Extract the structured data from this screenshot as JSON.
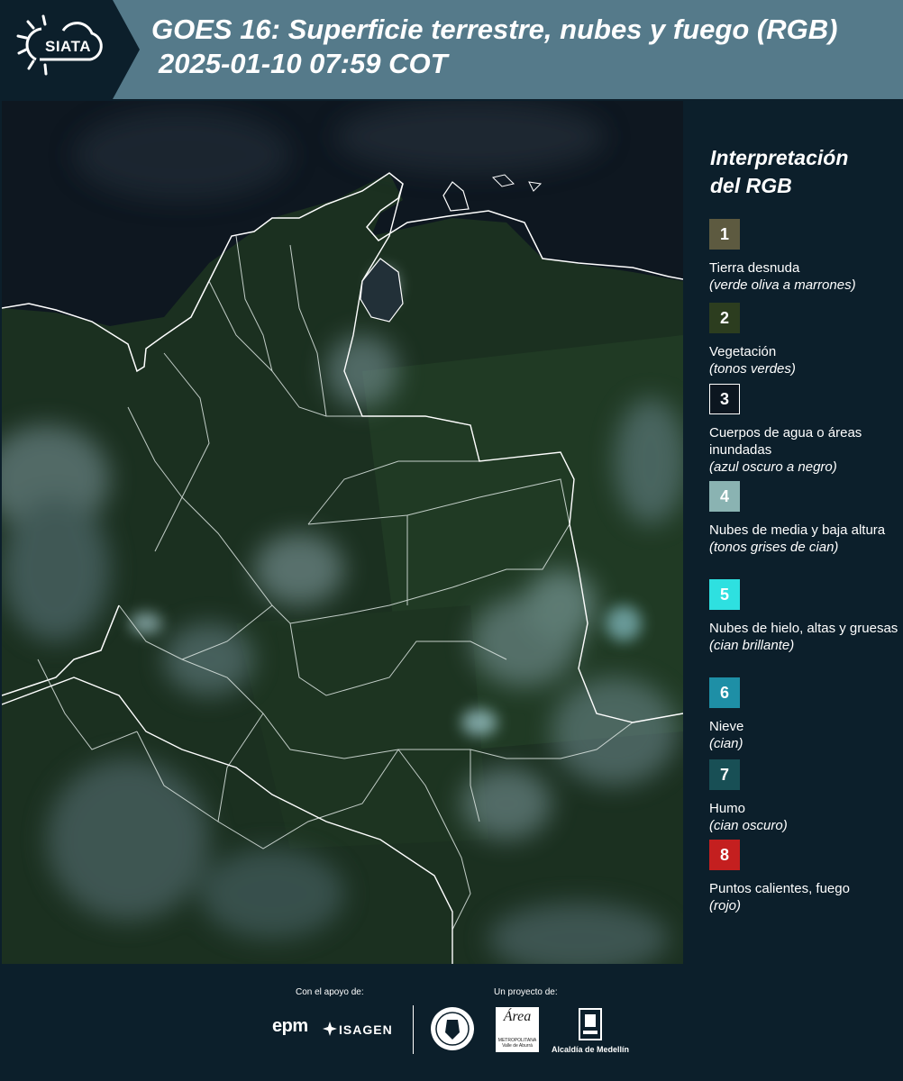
{
  "header": {
    "logo": "SIATA",
    "title_line1": "GOES 16: Superficie terrestre, nubes y fuego (RGB)",
    "title_line2": "2025-01-10 07:59 COT",
    "background": "#557a8a"
  },
  "legend": {
    "title_line1": "Interpretación",
    "title_line2": "del RGB",
    "items": [
      {
        "number": "1",
        "label": "Tierra desnuda",
        "sub": "(verde oliva a marrones)",
        "color": "#5d5a40"
      },
      {
        "number": "2",
        "label": "Vegetación",
        "sub": "(tonos verdes)",
        "color": "#2c3d1f"
      },
      {
        "number": "3",
        "label": "Cuerpos de agua o áreas inundadas",
        "sub": "(azul oscuro a negro)",
        "color": "#0c1620"
      },
      {
        "number": "4",
        "label": "Nubes de media y baja altura",
        "sub": "(tonos grises de cian)",
        "color": "#8ab3b2"
      },
      {
        "number": "5",
        "label": "Nubes de hielo, altas y gruesas",
        "sub": "(cian brillante)",
        "color": "#2ee0e0"
      },
      {
        "number": "6",
        "label": "Nieve",
        "sub": "(cian)",
        "color": "#1e8fa6"
      },
      {
        "number": "7",
        "label": "Humo",
        "sub": "(cian oscuro)",
        "color": "#184f55"
      },
      {
        "number": "8",
        "label": "Puntos calientes, fuego",
        "sub": "(rojo)",
        "color": "#c41f1f"
      }
    ]
  },
  "footer": {
    "support_label": "Con el apoyo de:",
    "project_label": "Un proyecto de:",
    "support_logos": [
      "epm",
      "ISAGEN"
    ],
    "project_logos": [
      "Universidad de Medellín seal",
      "Área Metropolitana Valle de Aburrá",
      "Alcaldía de Medellín"
    ],
    "epm_text": "epm",
    "isagen_text": "ISAGEN",
    "area_text": "Área",
    "area_sub": "METROPOLITANA Valle de Aburrá",
    "alcaldia_text": "Alcaldía de Medellín"
  }
}
